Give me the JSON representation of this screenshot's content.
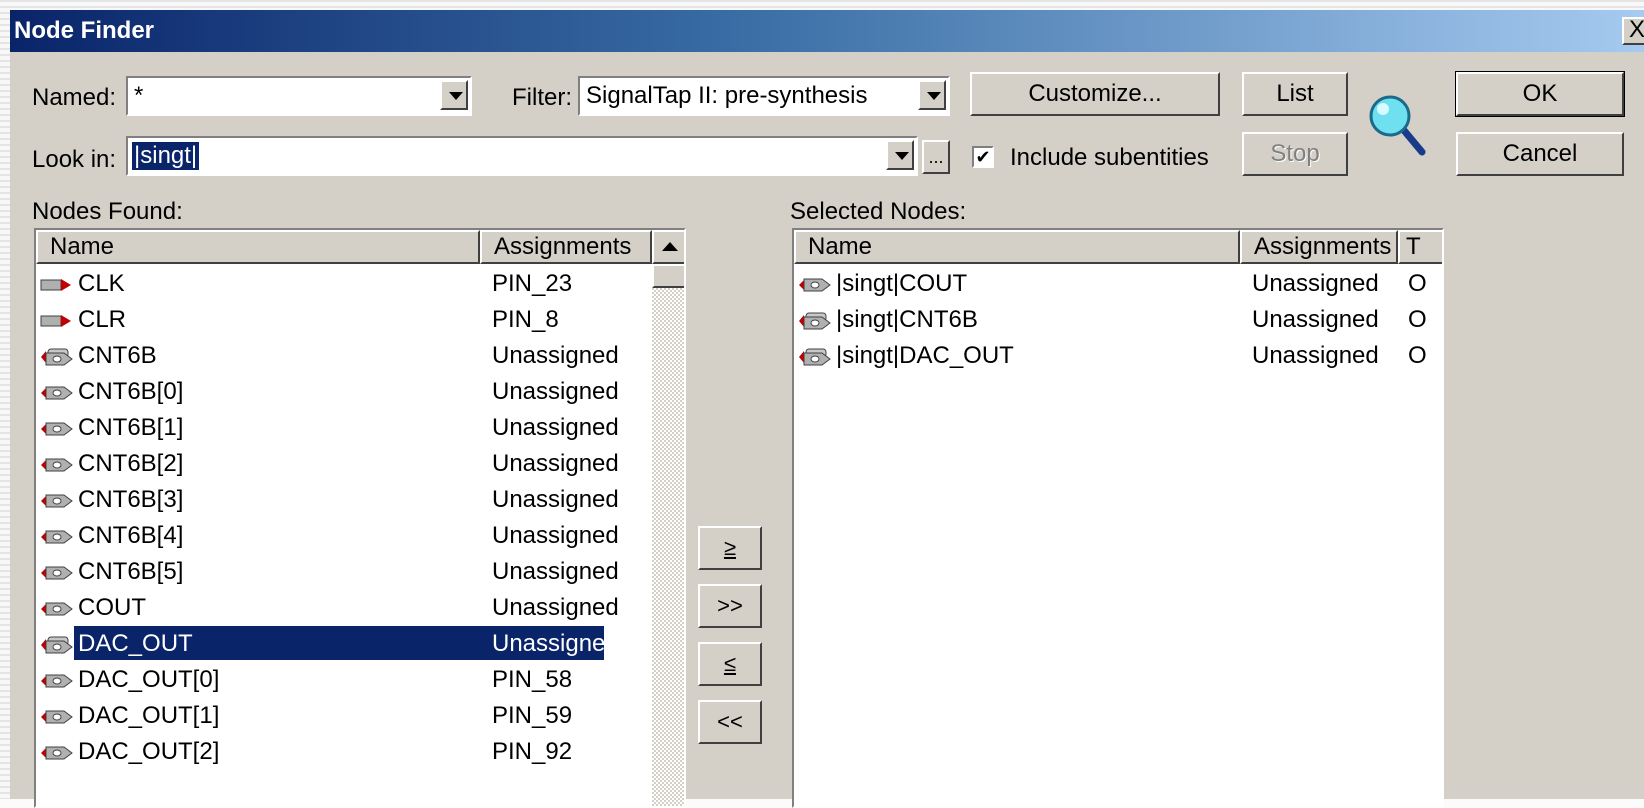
{
  "window": {
    "title": "Node Finder",
    "close_glyph": "X"
  },
  "form": {
    "named_label": "Named:",
    "named_value": "*",
    "filter_label": "Filter:",
    "filter_value": "SignalTap II: pre-synthesis",
    "look_in_label": "Look in:",
    "look_in_value": "|singt|",
    "browse_label": "...",
    "include_subentities_label": "Include subentities",
    "include_subentities_checked": true
  },
  "buttons": {
    "customize": "Customize...",
    "list": "List",
    "stop": "Stop",
    "ok": "OK",
    "cancel": "Cancel",
    "add": "≥",
    "add_all": ">>",
    "remove": "≤",
    "remove_all": "<<"
  },
  "nodes_found": {
    "label": "Nodes Found:",
    "headers": {
      "name": "Name",
      "assignments": "Assignments"
    },
    "rows": [
      {
        "icon": "input-pin-icon",
        "name": "CLK",
        "assignments": "PIN_23"
      },
      {
        "icon": "input-pin-icon",
        "name": "CLR",
        "assignments": "PIN_8"
      },
      {
        "icon": "output-bus-icon",
        "name": "CNT6B",
        "assignments": "Unassigned"
      },
      {
        "icon": "output-pin-icon",
        "name": "CNT6B[0]",
        "assignments": "Unassigned"
      },
      {
        "icon": "output-pin-icon",
        "name": "CNT6B[1]",
        "assignments": "Unassigned"
      },
      {
        "icon": "output-pin-icon",
        "name": "CNT6B[2]",
        "assignments": "Unassigned"
      },
      {
        "icon": "output-pin-icon",
        "name": "CNT6B[3]",
        "assignments": "Unassigned"
      },
      {
        "icon": "output-pin-icon",
        "name": "CNT6B[4]",
        "assignments": "Unassigned"
      },
      {
        "icon": "output-pin-icon",
        "name": "CNT6B[5]",
        "assignments": "Unassigned"
      },
      {
        "icon": "output-pin-icon",
        "name": "COUT",
        "assignments": "Unassigned"
      },
      {
        "icon": "output-bus-icon",
        "name": "DAC_OUT",
        "assignments": "Unassigned",
        "selected": true
      },
      {
        "icon": "output-pin-icon",
        "name": "DAC_OUT[0]",
        "assignments": "PIN_58"
      },
      {
        "icon": "output-pin-icon",
        "name": "DAC_OUT[1]",
        "assignments": "PIN_59"
      },
      {
        "icon": "output-pin-icon",
        "name": "DAC_OUT[2]",
        "assignments": "PIN_92"
      }
    ]
  },
  "selected_nodes": {
    "label": "Selected Nodes:",
    "headers": {
      "name": "Name",
      "assignments": "Assignments",
      "type": "T"
    },
    "rows": [
      {
        "icon": "output-pin-icon",
        "name": "|singt|COUT",
        "assignments": "Unassigned",
        "type": "O"
      },
      {
        "icon": "output-bus-icon",
        "name": "|singt|CNT6B",
        "assignments": "Unassigned",
        "type": "O"
      },
      {
        "icon": "output-bus-icon",
        "name": "|singt|DAC_OUT",
        "assignments": "Unassigned",
        "type": "O"
      }
    ]
  },
  "colors": {
    "title_start": "#0a246a",
    "title_end": "#a6caf0",
    "face": "#d4d0c8",
    "selection": "#0a246a"
  }
}
